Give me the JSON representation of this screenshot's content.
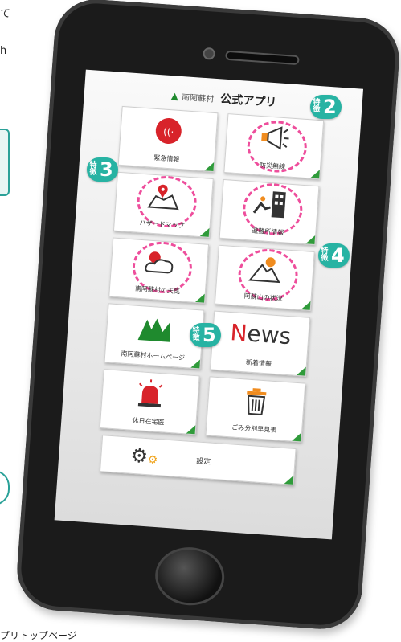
{
  "page": {
    "left_text_1": "て",
    "left_text_2": "h",
    "caption": "プリトップページ"
  },
  "app": {
    "sub_title": "南阿蘇村",
    "title": "公式アプリ"
  },
  "tiles": [
    {
      "label": "緊急情報",
      "icon": "alert-signal-icon",
      "glyph": "((·))"
    },
    {
      "label": "防災無線",
      "icon": "megaphone-icon",
      "glyph": "📢"
    },
    {
      "label": "ハザードマップ",
      "icon": "map-pin-icon",
      "glyph": "📍"
    },
    {
      "label": "避難所情報",
      "icon": "evacuation-icon",
      "glyph": "🏢"
    },
    {
      "label": "南阿蘇村の天気",
      "icon": "weather-icon",
      "glyph": "⛅"
    },
    {
      "label": "阿蘇山の状況",
      "icon": "volcano-icon",
      "glyph": "🌋"
    },
    {
      "label": "南阿蘇村ホームページ",
      "icon": "village-logo-icon",
      "glyph": "M"
    },
    {
      "label": "新着情報",
      "icon": "news-icon",
      "glyph": "News"
    },
    {
      "label": "休日在宅医",
      "icon": "siren-icon",
      "glyph": "🚨"
    },
    {
      "label": "ごみ分別早見表",
      "icon": "trash-can-icon",
      "glyph": "🗑"
    },
    {
      "label": "設定",
      "icon": "settings-gear-icon",
      "glyph": "⚙"
    }
  ],
  "badges": [
    {
      "prefix": "特徴",
      "number": "2"
    },
    {
      "prefix": "特徴",
      "number": "3"
    },
    {
      "prefix": "特徴",
      "number": "4"
    },
    {
      "prefix": "特徴",
      "number": "5"
    }
  ],
  "colors": {
    "badge": "#27b3a3",
    "highlight_ring": "#ee4e9c",
    "tile_corner": "#2f9b3a",
    "emergency_red": "#d8232a"
  }
}
